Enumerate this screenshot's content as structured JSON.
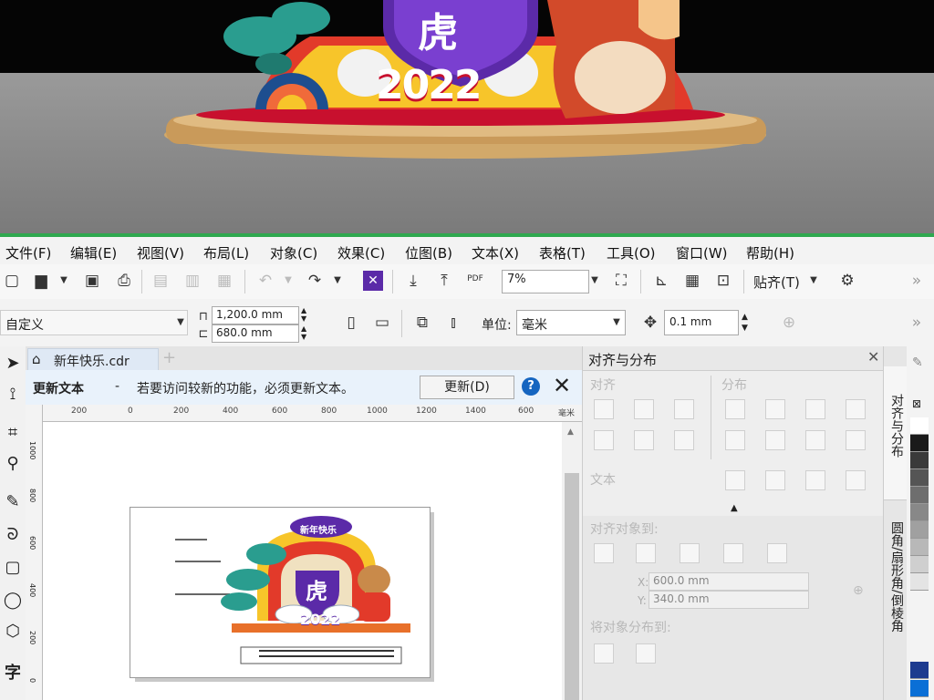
{
  "menu": [
    "文件(F)",
    "编辑(E)",
    "视图(V)",
    "布局(L)",
    "对象(C)",
    "效果(C)",
    "位图(B)",
    "文本(X)",
    "表格(T)",
    "工具(O)",
    "窗口(W)",
    "帮助(H)"
  ],
  "toolbar": {
    "zoom": "7%",
    "snap_label": "贴齐(T)",
    "pdf_label": "PDF"
  },
  "property_bar": {
    "preset": "自定义",
    "width": "1,200.0 mm",
    "height": "680.0 mm",
    "unit_label": "单位:",
    "unit_value": "毫米",
    "nudge": "0.1 mm"
  },
  "document": {
    "tab_name": "新年快乐.cdr",
    "info_title": "更新文本",
    "info_dash": "-",
    "info_message": "若要访问较新的功能，必须更新文本。",
    "update_button": "更新(D)",
    "ruler_top": [
      "200",
      "0",
      "200",
      "400",
      "600",
      "800",
      "1000",
      "1200",
      "1400",
      "600"
    ],
    "ruler_unit": "毫米",
    "ruler_left": [
      "1000",
      "800",
      "600",
      "400",
      "200",
      "0"
    ],
    "artwork": {
      "banner": "新年快乐",
      "tiger_char": "虎",
      "year": "2022"
    }
  },
  "render": {
    "tiger_char": "虎",
    "year": "2022"
  },
  "docker": {
    "title": "对齐与分布",
    "align_label": "对齐",
    "distribute_label": "分布",
    "text_label": "文本",
    "align_to_label": "对齐对象到:",
    "x_value": "600.0 mm",
    "y_value": "340.0 mm",
    "x_axis": "X:",
    "y_axis": "Y:",
    "distribute_to_label": "将对象分布到:"
  },
  "side_tabs": [
    "对齐与分布",
    "圆角/扇形角/倒棱角"
  ],
  "palette": [
    "#ffffff",
    "#1a1a1a",
    "#3a3a3a",
    "#555555",
    "#6e6e6e",
    "#888888",
    "#a0a0a0",
    "#b8b8b8",
    "#cfcfcf",
    "#e4e4e4",
    "#1d3b8f",
    "#0a6fd6"
  ],
  "colors": {
    "render_red": "#c8102e",
    "render_purple": "#5b2aa8",
    "render_teal": "#2a9d8f",
    "info_bg": "#e9f2fb",
    "accent_blue": "#1565c0"
  }
}
